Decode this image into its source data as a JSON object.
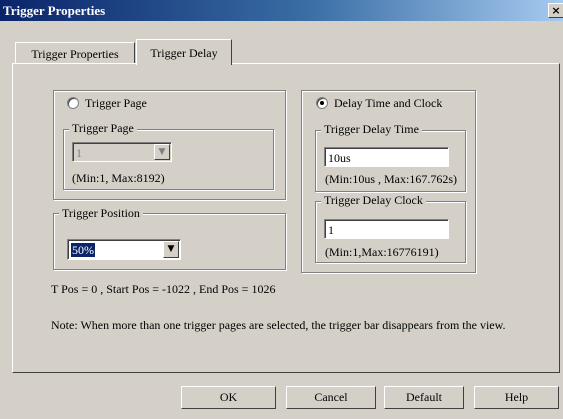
{
  "window": {
    "title": "Trigger Properties",
    "close_label": "×"
  },
  "tabs": [
    {
      "label": "Trigger Properties"
    },
    {
      "label": "Trigger Delay"
    }
  ],
  "trigger_page": {
    "radio_label": "Trigger Page",
    "group_label": "Trigger Page",
    "value": "1",
    "range": "(Min:1, Max:8192)"
  },
  "trigger_position": {
    "group_label": "Trigger Position",
    "value": "50%"
  },
  "delay": {
    "radio_label": "Delay Time and Clock",
    "time_group": "Trigger Delay Time",
    "time_value": "10us",
    "time_range": "(Min:10us , Max:167.762s)",
    "clock_group": "Trigger Delay Clock",
    "clock_value": "1",
    "clock_range": "(Min:1,Max:16776191)"
  },
  "positions_text": "T Pos = 0 , Start Pos = -1022 , End Pos = 1026",
  "note": "Note: When more than one trigger pages are selected, the trigger bar disappears from the view.",
  "buttons": {
    "ok": "OK",
    "cancel": "Cancel",
    "default": "Default",
    "help": "Help"
  },
  "icons": {
    "dropdown": "▼",
    "close": "close-icon"
  }
}
